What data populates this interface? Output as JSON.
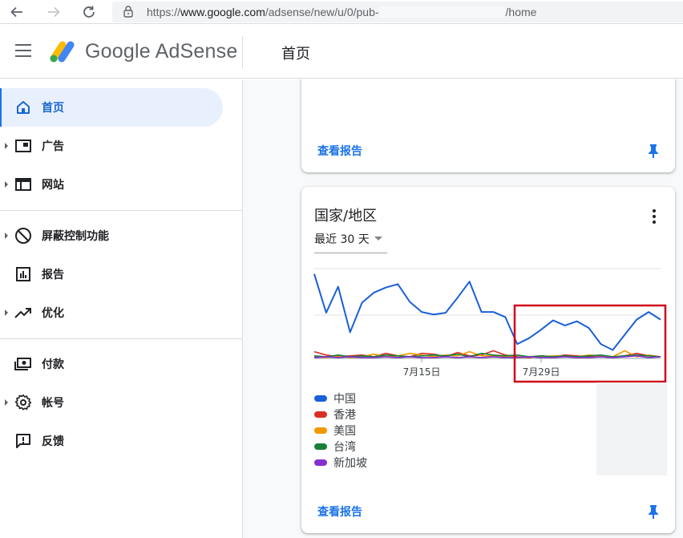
{
  "browser": {
    "url_prefix": "https://",
    "url_domain": "www.google.com",
    "url_path": "/adsense/new/u/0/pub-",
    "url_suffix": "/home"
  },
  "header": {
    "logo_text": "Google AdSense",
    "page_title": "首页"
  },
  "sidebar": {
    "items": [
      {
        "label": "首页",
        "icon": "home-icon"
      },
      {
        "label": "广告",
        "icon": "ads-icon"
      },
      {
        "label": "网站",
        "icon": "sites-icon"
      },
      {
        "label": "屏蔽控制功能",
        "icon": "block-icon"
      },
      {
        "label": "报告",
        "icon": "reports-icon"
      },
      {
        "label": "优化",
        "icon": "optimize-icon"
      },
      {
        "label": "付款",
        "icon": "payments-icon"
      },
      {
        "label": "帐号",
        "icon": "gear-icon"
      },
      {
        "label": "反馈",
        "icon": "feedback-icon"
      }
    ]
  },
  "top_card": {
    "link": "查看报告"
  },
  "geo_card": {
    "title": "国家/地区",
    "range": "最近 30 天",
    "link": "查看报告"
  },
  "chart_data": {
    "type": "line",
    "x_ticks": [
      "7月15日",
      "7月29日"
    ],
    "series": [
      {
        "name": "中国",
        "color": "#1a5fd6",
        "values": [
          100,
          54,
          85,
          31,
          66,
          78,
          84,
          88,
          67,
          55,
          52,
          54,
          72,
          91,
          55,
          55,
          49,
          17,
          24,
          34,
          45,
          39,
          44,
          36,
          17,
          10,
          28,
          46,
          55,
          46
        ]
      },
      {
        "name": "香港",
        "color": "#d93025",
        "values": [
          8,
          4,
          2,
          3,
          4,
          2,
          6,
          3,
          2,
          6,
          5,
          2,
          7,
          3,
          4,
          9,
          4,
          2,
          1,
          3,
          2,
          4,
          3,
          2,
          2,
          1,
          3,
          6,
          3,
          2
        ]
      },
      {
        "name": "美国",
        "color": "#f29900",
        "values": [
          2,
          1,
          3,
          1,
          2,
          5,
          2,
          3,
          6,
          4,
          2,
          4,
          3,
          8,
          3,
          3,
          2,
          1,
          2,
          2,
          3,
          3,
          2,
          4,
          3,
          2,
          9,
          2,
          4,
          2
        ]
      },
      {
        "name": "台湾",
        "color": "#188038",
        "values": [
          3,
          2,
          4,
          2,
          3,
          2,
          4,
          3,
          2,
          3,
          4,
          3,
          5,
          2,
          6,
          4,
          3,
          4,
          2,
          3,
          2,
          3,
          2,
          3,
          4,
          2,
          3,
          4,
          3,
          2
        ]
      },
      {
        "name": "新加坡",
        "color": "#8430ce",
        "values": [
          1,
          2,
          1,
          2,
          1,
          1,
          2,
          1,
          2,
          1,
          1,
          2,
          1,
          2,
          1,
          2,
          1,
          1,
          2,
          1,
          1,
          2,
          1,
          1,
          2,
          1,
          2,
          3,
          1,
          2
        ]
      }
    ]
  }
}
